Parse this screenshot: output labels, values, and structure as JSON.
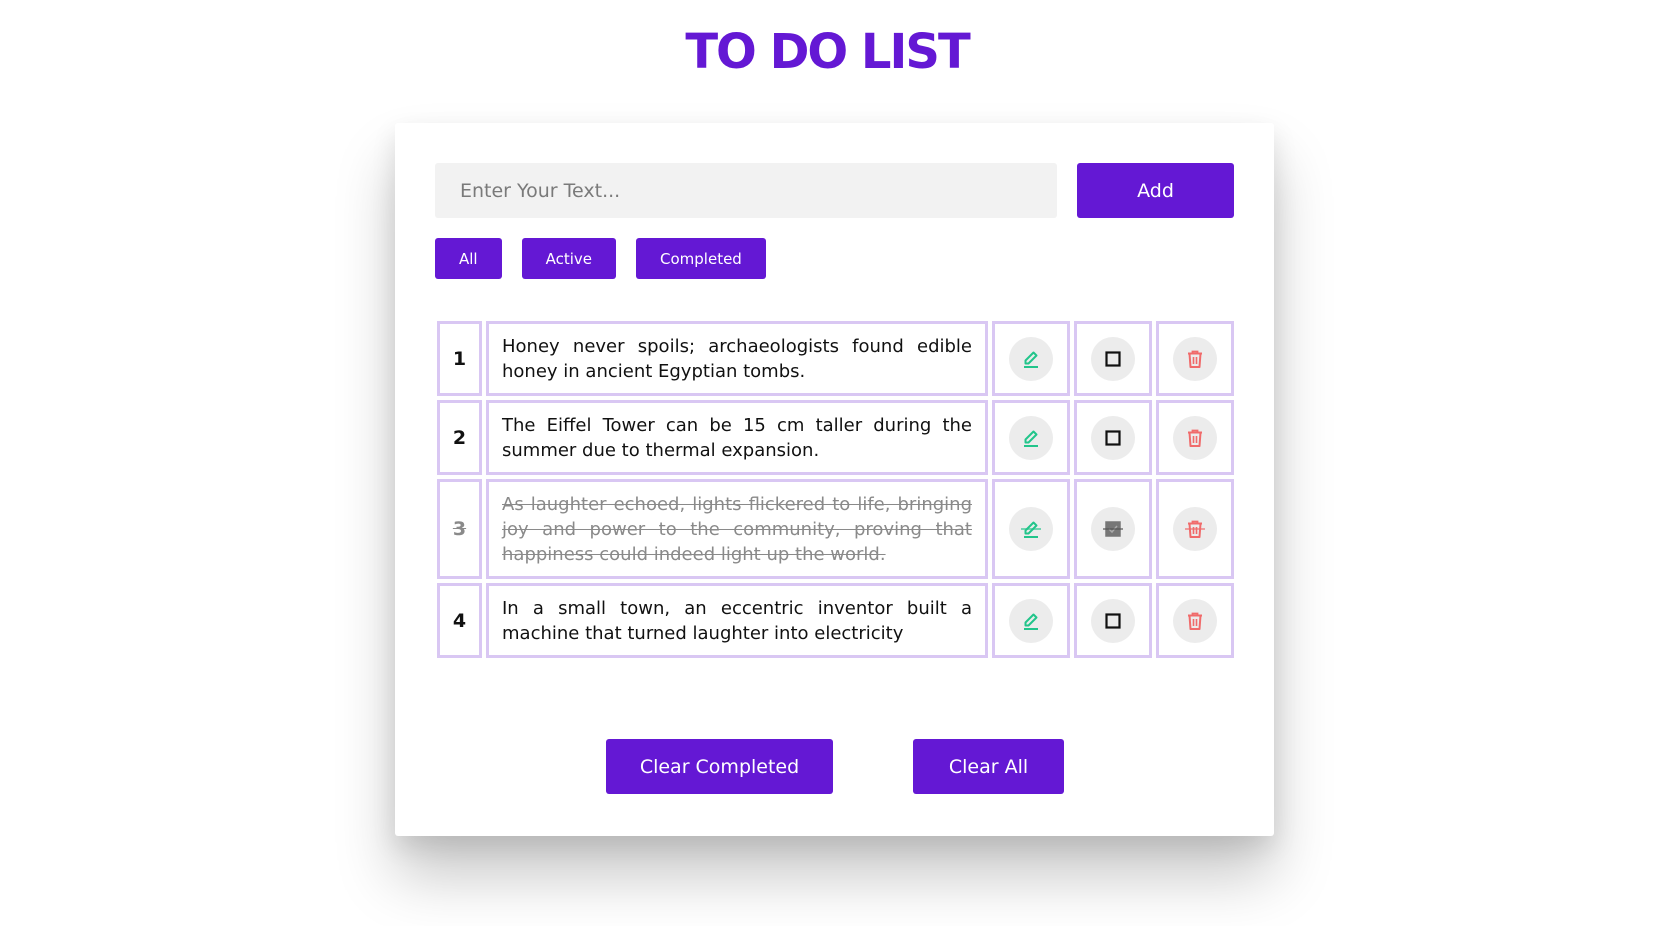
{
  "app": {
    "title": "TO DO LIST"
  },
  "input": {
    "placeholder": "Enter Your Text...",
    "value": ""
  },
  "add_button": {
    "label": "Add"
  },
  "filters": [
    {
      "label": "All"
    },
    {
      "label": "Active"
    },
    {
      "label": "Completed"
    }
  ],
  "todos": [
    {
      "number": "1",
      "text": "Honey never spoils; archaeologists found edible honey in ancient Egyptian tombs.",
      "completed": false
    },
    {
      "number": "2",
      "text": "The Eiffel Tower can be 15 cm taller during the summer due to thermal expansion.",
      "completed": false
    },
    {
      "number": "3",
      "text": "As laughter echoed, lights flickered to life, bringing joy and power to the community, proving that happiness could indeed light up the world.",
      "completed": true
    },
    {
      "number": "4",
      "text": "In a small town, an eccentric inventor built a machine that turned laughter into electricity",
      "completed": false
    }
  ],
  "row_actions": {
    "edit_icon": "pencil-icon",
    "toggle_icon": "checkbox-icon",
    "delete_icon": "trash-icon"
  },
  "bottom_buttons": {
    "clear_completed_label": "Clear Completed",
    "clear_all_label": "Clear All"
  },
  "colors": {
    "accent": "#6418d4",
    "table_border": "#d9c7f3",
    "edit_icon": "#22c58b",
    "delete_icon": "#f06b6b",
    "completed_text": "#8a8a8a"
  }
}
